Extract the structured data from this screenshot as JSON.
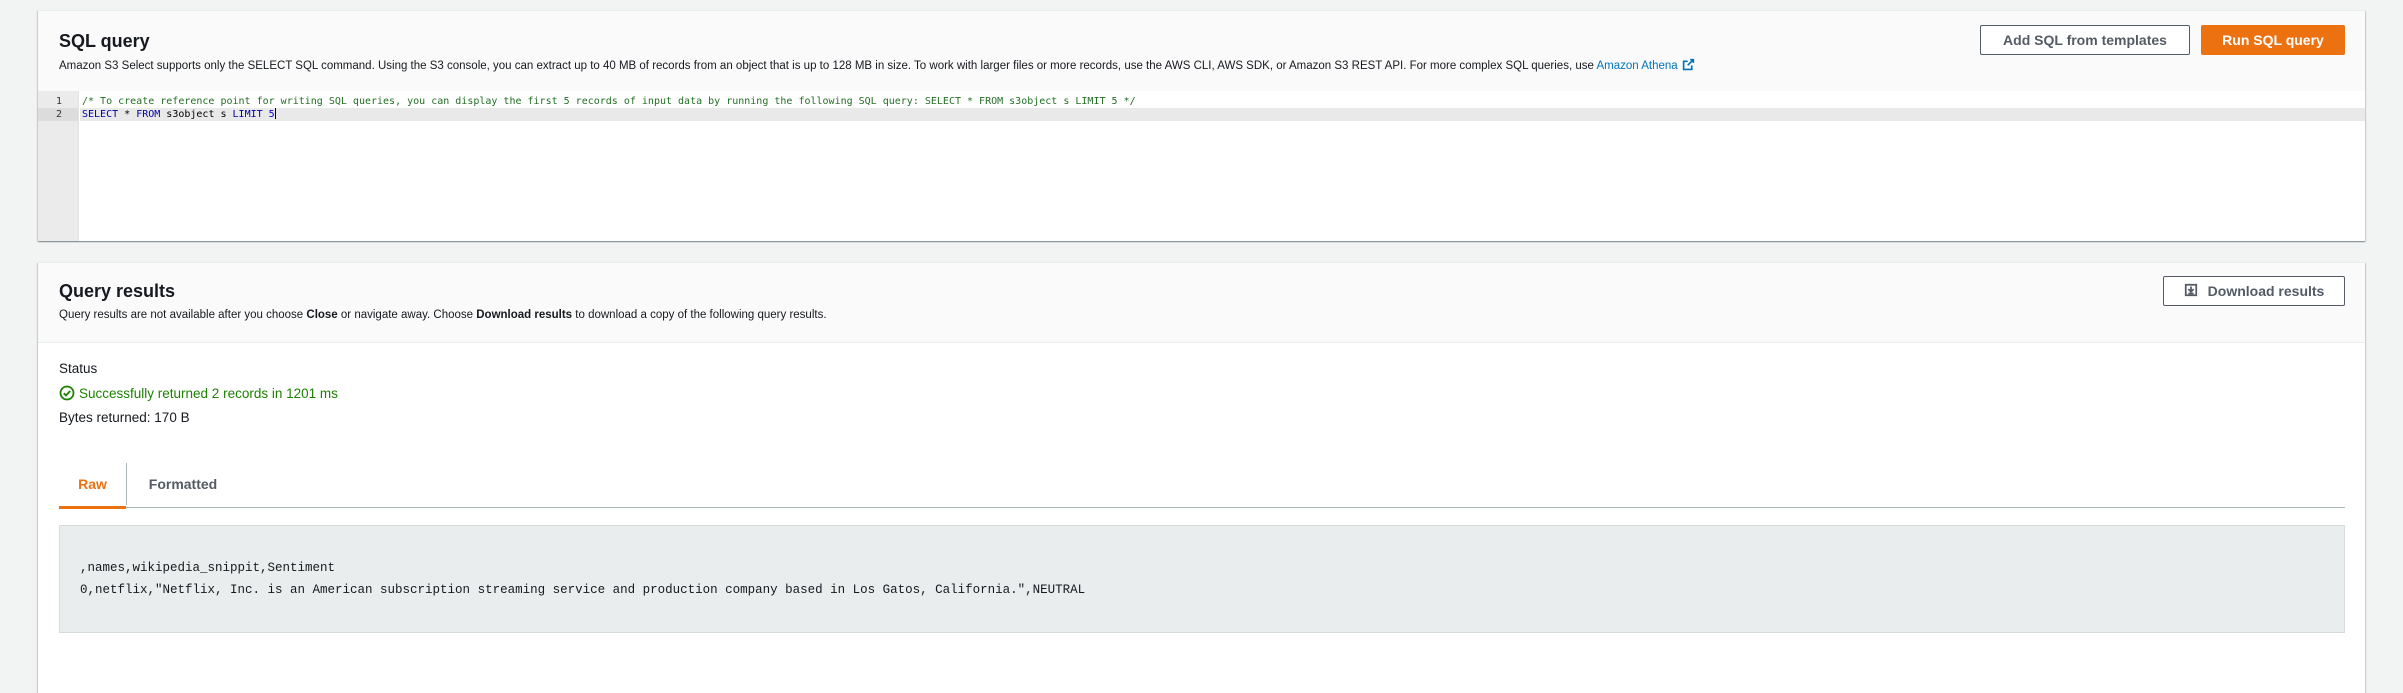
{
  "sql_query": {
    "title": "SQL query",
    "description": "Amazon S3 Select supports only the SELECT SQL command. Using the S3 console, you can extract up to 40 MB of records from an object that is up to 128 MB in size. To work with larger files or more records, use the AWS CLI, AWS SDK, or Amazon S3 REST API. For more complex SQL queries, use",
    "athena_link": "Amazon Athena",
    "add_templates_label": "Add SQL from templates",
    "run_label": "Run SQL query",
    "editor": {
      "line_numbers": [
        "1",
        "2"
      ],
      "line1_comment": "/* To create reference point for writing SQL queries, you can display the first 5 records of input data by running the following SQL query: SELECT * FROM s3object s LIMIT 5 */",
      "line2": {
        "kw_select": "SELECT",
        "star_from": " * ",
        "kw_from": "FROM",
        "table": " s3object s ",
        "kw_limit": "LIMIT",
        "num": " 5"
      }
    }
  },
  "query_results": {
    "title": "Query results",
    "desc_part1": "Query results are not available after you choose ",
    "desc_close": "Close",
    "desc_part2": " or navigate away. Choose ",
    "desc_download": "Download results",
    "desc_part3": " to download a copy of the following query results.",
    "download_label": "Download results",
    "status_label": "Status",
    "status_text": "Successfully returned 2 records in 1201 ms",
    "bytes_returned": "Bytes returned: 170 B",
    "tabs": [
      {
        "label": "Raw",
        "active": true
      },
      {
        "label": "Formatted",
        "active": false
      }
    ],
    "raw_lines": [
      ",names,wikipedia_snippit,Sentiment",
      "0,netflix,\"Netflix, Inc. is an American subscription streaming service and production company based in Los Gatos, California.\",NEUTRAL"
    ]
  },
  "colors": {
    "primary": "#ec7211",
    "link": "#0073bb",
    "success": "#1d8102"
  }
}
